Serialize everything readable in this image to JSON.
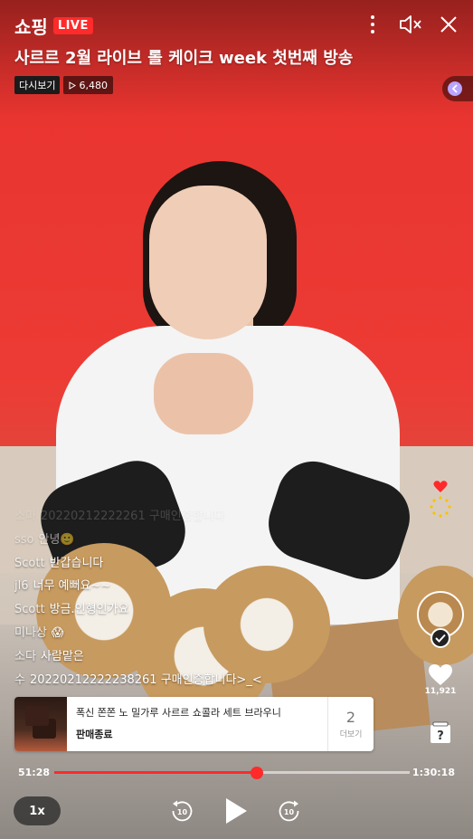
{
  "header": {
    "logo": "쇼핑",
    "live_badge": "LIVE",
    "title": "사르르 2월 라이브 롤 케이크 week 첫번째 방송",
    "replay_label": "다시보기",
    "view_count": "6,480",
    "icons": [
      "more-vertical-icon",
      "mute-icon",
      "close-icon"
    ]
  },
  "chat": [
    {
      "user": "소마",
      "message": "20220212222261 구매인증합니다"
    },
    {
      "user": "sso",
      "message": "안녕🙂"
    },
    {
      "user": "Scott",
      "message": "반갑습니다"
    },
    {
      "user": "jl6",
      "message": "너무 예뻐요~~"
    },
    {
      "user": "Scott",
      "message": "방금.인형인가요"
    },
    {
      "user": "미나상",
      "message": "😱"
    },
    {
      "user": "소다",
      "message": "사람맡은"
    },
    {
      "user": "수",
      "message": "20220212222238261 구매인증합니다>_<"
    }
  ],
  "side": {
    "like_count": "11,921"
  },
  "product": {
    "name": "폭신 쫀쫀 노 밀가루 사르르 쇼콜라 세트 브라우니",
    "status": "판매종료",
    "more_count": "2",
    "more_label": "더보기"
  },
  "player": {
    "current_time": "51:28",
    "total_time": "1:30:18",
    "progress": 0.57,
    "speed_label": "1x",
    "rewind_seconds": "10",
    "forward_seconds": "10"
  },
  "colors": {
    "accent": "#ff2a2a",
    "background_wall": "#e8322e"
  }
}
